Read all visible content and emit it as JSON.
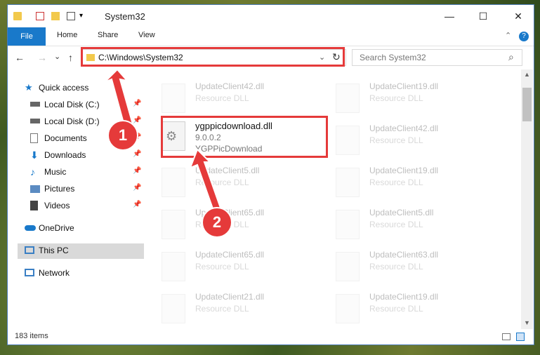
{
  "window": {
    "title": "System32",
    "minimize": "—",
    "maximize": "☐",
    "close": "✕",
    "help": "?"
  },
  "ribbon": {
    "file": "File",
    "home": "Home",
    "share": "Share",
    "view": "View",
    "collapse": "⌃"
  },
  "nav": {
    "back": "←",
    "forward": "→",
    "dropdown": "⌄",
    "up": "↑",
    "address": "C:\\Windows\\System32",
    "refresh": "↻",
    "address_dropdown": "⌄",
    "search_placeholder": "Search System32",
    "search_icon": "⌕"
  },
  "sidebar": {
    "quick_access": "Quick access",
    "items": [
      {
        "label": "Local Disk (C:)",
        "pin": "📌"
      },
      {
        "label": "Local Disk (D:)",
        "pin": "📌"
      },
      {
        "label": "Documents",
        "pin": "📌"
      },
      {
        "label": "Downloads",
        "pin": "📌"
      },
      {
        "label": "Music",
        "pin": "📌"
      },
      {
        "label": "Pictures",
        "pin": "📌"
      },
      {
        "label": "Videos",
        "pin": "📌"
      }
    ],
    "onedrive": "OneDrive",
    "this_pc": "This PC",
    "network": "Network"
  },
  "files_left": [
    {
      "name": "UpdateClient42.dll",
      "type": "Resource DLL"
    },
    {
      "name": "ygppicdownload.dll",
      "version": "9.0.0.2",
      "desc": "YGPPicDownload"
    },
    {
      "name": "UpdateClient5.dll",
      "type": "Resource DLL"
    },
    {
      "name": "UpdateClient65.dll",
      "type": "Resource DLL"
    },
    {
      "name": "UpdateClient65.dll",
      "type": "Resource DLL"
    },
    {
      "name": "UpdateClient21.dll",
      "type": "Resource DLL"
    }
  ],
  "files_right": [
    {
      "name": "UpdateClient19.dll",
      "type": "Resource DLL"
    },
    {
      "name": "UpdateClient42.dll",
      "type": "Resource DLL"
    },
    {
      "name": "UpdateClient19.dll",
      "type": "Resource DLL"
    },
    {
      "name": "UpdateClient5.dll",
      "type": "Resource DLL"
    },
    {
      "name": "UpdateClient63.dll",
      "type": "Resource DLL"
    },
    {
      "name": "UpdateClient19.dll",
      "type": "Resource DLL"
    }
  ],
  "status": {
    "count": "183 items"
  },
  "annotations": {
    "step1": "1",
    "step2": "2"
  },
  "colors": {
    "accent": "#1979ca",
    "highlight": "#e53a3a"
  }
}
